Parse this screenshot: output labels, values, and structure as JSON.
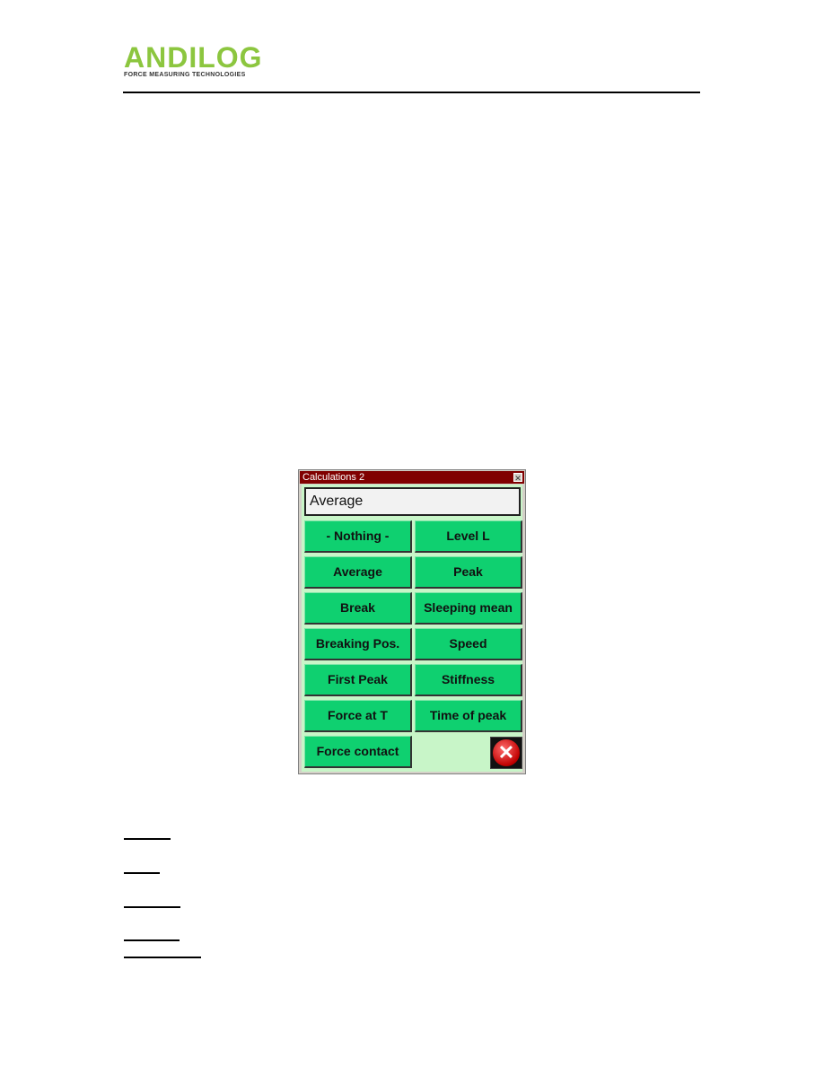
{
  "header": {
    "logo_text": "ANDILOG",
    "logo_tagline": "FORCE MEASURING TECHNOLOGIES",
    "brand_color": "#8cc63f"
  },
  "dialog": {
    "title": "Calculations 2",
    "display_value": "Average",
    "button_color": "#0fd070",
    "buttons": [
      {
        "label": "- Nothing -"
      },
      {
        "label": "Level L"
      },
      {
        "label": "Average"
      },
      {
        "label": "Peak"
      },
      {
        "label": "Break"
      },
      {
        "label": "Sleeping mean"
      },
      {
        "label": "Breaking Pos."
      },
      {
        "label": "Speed"
      },
      {
        "label": "First Peak"
      },
      {
        "label": "Stiffness"
      },
      {
        "label": "Force at T"
      },
      {
        "label": "Time of peak"
      },
      {
        "label": "Force contact"
      }
    ],
    "close_icon": "close-icon",
    "exit_icon": "red-x-icon"
  }
}
